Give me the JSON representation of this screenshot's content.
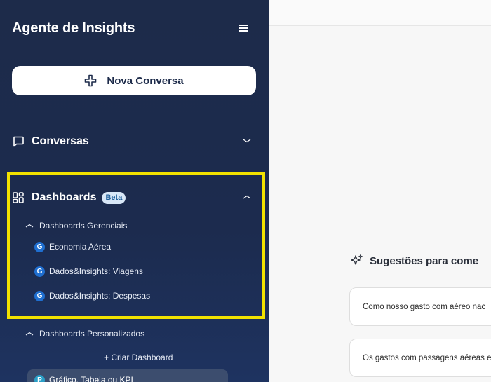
{
  "app": {
    "title": "Agente de Insights"
  },
  "sidebar": {
    "new_chat_label": "Nova Conversa",
    "conversations_label": "Conversas",
    "dashboards_label": "Dashboards",
    "beta_badge": "Beta",
    "groups": [
      {
        "label": "Dashboards Gerenciais",
        "items": [
          {
            "badge": "G",
            "label": "Economia Aérea"
          },
          {
            "badge": "G",
            "label": "Dados&Insights: Viagens"
          },
          {
            "badge": "G",
            "label": "Dados&Insights: Despesas"
          }
        ]
      },
      {
        "label": "Dashboards Personalizados"
      }
    ],
    "create_dashboard_label": "+ Criar Dashboard",
    "pinned_item": {
      "badge": "P",
      "label": "Gráfico, Tabela ou KPI"
    }
  },
  "main": {
    "suggestions_title": "Sugestões para come",
    "suggestions": [
      "Como nosso gasto com aéreo nac",
      "Os gastos com passagens aéreas e"
    ]
  },
  "colors": {
    "sidebar_bg": "#1d2b4a",
    "highlight": "#f2e200",
    "accent": "#1f6fd1"
  },
  "icons": [
    "menu-icon",
    "plus-icon",
    "chat-bubble-icon",
    "dashboard-grid-icon",
    "chevron-down-icon",
    "chevron-up-icon",
    "sparkle-icon"
  ]
}
